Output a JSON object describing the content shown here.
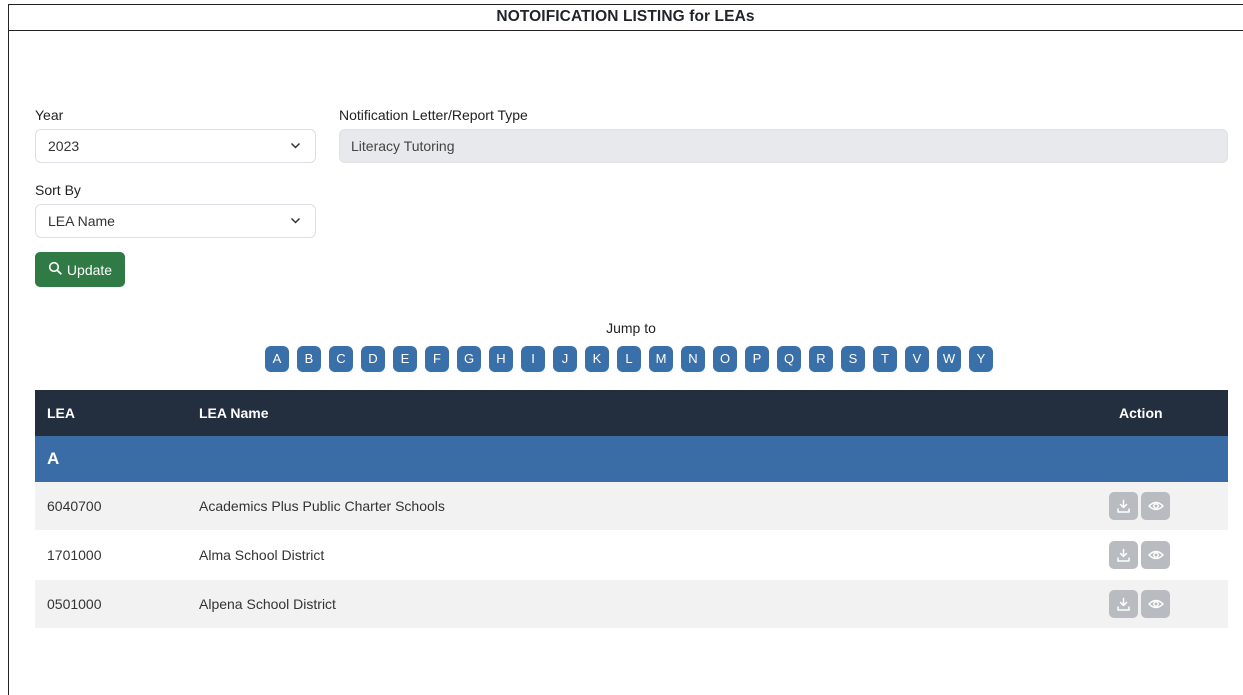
{
  "page": {
    "title": "NOTOIFICATION LISTING for LEAs"
  },
  "filters": {
    "year_label": "Year",
    "year_value": "2023",
    "type_label": "Notification Letter/Report Type",
    "type_value": "Literacy Tutoring",
    "sort_label": "Sort By",
    "sort_value": "LEA Name",
    "update_label": "Update"
  },
  "jump": {
    "label": "Jump to",
    "letters": [
      "A",
      "B",
      "C",
      "D",
      "E",
      "F",
      "G",
      "H",
      "I",
      "J",
      "K",
      "L",
      "M",
      "N",
      "O",
      "P",
      "Q",
      "R",
      "S",
      "T",
      "V",
      "W",
      "Y"
    ]
  },
  "table": {
    "headers": {
      "lea": "LEA",
      "name": "LEA Name",
      "action": "Action"
    },
    "group": "A",
    "rows": [
      {
        "lea": "6040700",
        "name": "Academics Plus Public Charter Schools"
      },
      {
        "lea": "1701000",
        "name": "Alma School District"
      },
      {
        "lea": "0501000",
        "name": "Alpena School District"
      }
    ]
  },
  "icons": {
    "update": "search-icon",
    "download": "download-icon",
    "view": "eye-icon",
    "select": "chevron-down-icon"
  },
  "colors": {
    "update_button": "#2f7a45",
    "letter_button": "#3a70aa",
    "table_header": "#232e3f",
    "group_row": "#3a6ca6",
    "action_button": "#b8bcc0"
  }
}
